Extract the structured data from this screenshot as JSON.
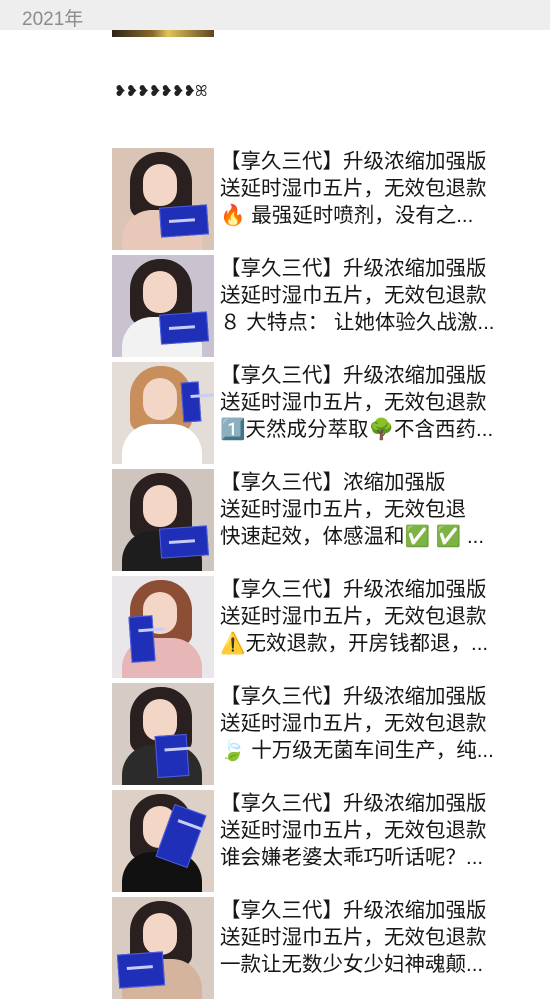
{
  "header": {
    "year": "2021年"
  },
  "emoji_strip": {
    "text": "❥❥❥❥❥❥❥ꕤ"
  },
  "posts": [
    {
      "line1": "【享久三代】升级浓缩加强版",
      "line2": "送延时湿巾五片，无效包退款",
      "line3": "🔥 最强延时喷剂，没有之..."
    },
    {
      "line1": "【享久三代】升级浓缩加强版",
      "line2": "送延时湿巾五片，无效包退款",
      "line3": "８ 大特点： 让她体验久战激..."
    },
    {
      "line1": "【享久三代】升级浓缩加强版",
      "line2": "送延时湿巾五片，无效包退款",
      "line3": "1️⃣天然成分萃取🌳不含西药..."
    },
    {
      "line1": "【享久三代】浓缩加强版",
      "line2": "送延时湿巾五片，无效包退",
      "line3": "快速起效，体感温和✅ ✅ ..."
    },
    {
      "line1": "【享久三代】升级浓缩加强版",
      "line2": "送延时湿巾五片，无效包退款",
      "line3": "⚠️无效退款，开房钱都退，..."
    },
    {
      "line1": "【享久三代】升级浓缩加强版",
      "line2": "送延时湿巾五片，无效包退款",
      "line3": "🍃 十万级无菌车间生产，纯..."
    },
    {
      "line1": "【享久三代】升级浓缩加强版",
      "line2": "送延时湿巾五片，无效包退款",
      "line3": "谁会嫌老婆太乖巧听话呢？..."
    },
    {
      "line1": "【享久三代】升级浓缩加强版",
      "line2": "送延时湿巾五片，无效包退款",
      "line3": "一款让无数少女少妇神魂颠..."
    }
  ]
}
